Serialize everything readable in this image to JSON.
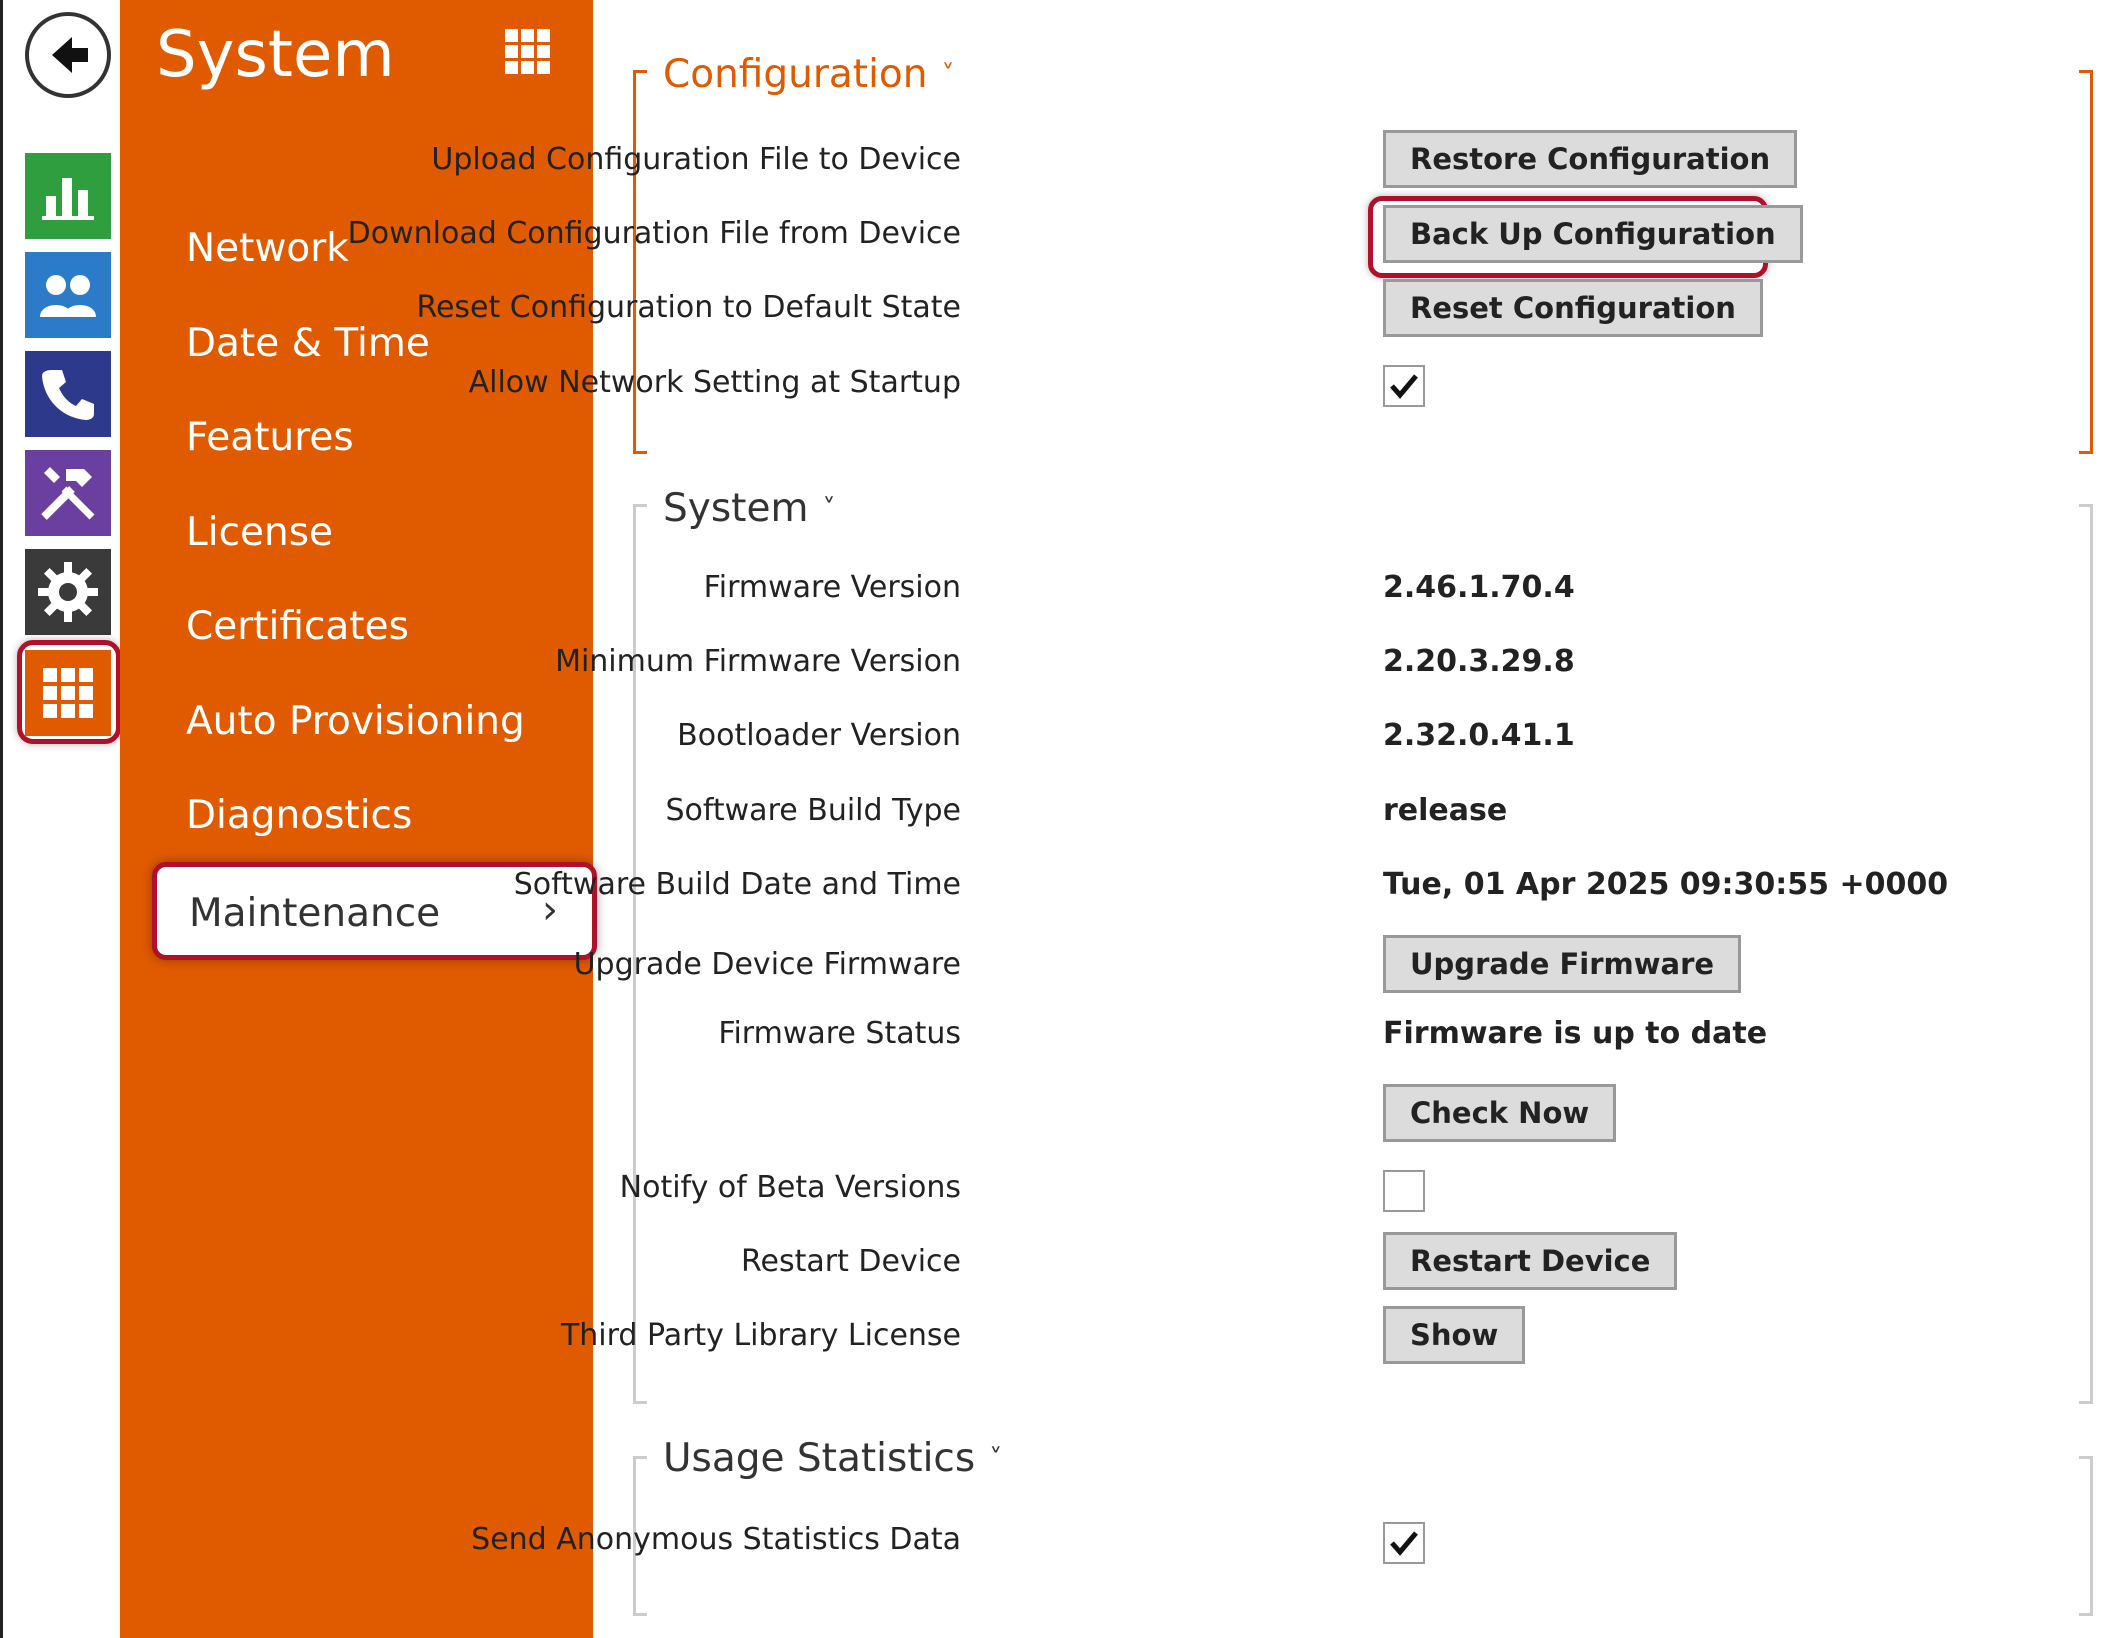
{
  "rail": {
    "icons": [
      "back-arrow-icon",
      "statistics-icon",
      "users-icon",
      "phone-icon",
      "tools-icon",
      "gear-icon",
      "grid-icon"
    ]
  },
  "menu": {
    "title": "System",
    "items": [
      "Network",
      "Date & Time",
      "Features",
      "License",
      "Certificates",
      "Auto Provisioning",
      "Diagnostics"
    ],
    "active": "Maintenance",
    "active_chevron": "›"
  },
  "configuration": {
    "title": "Configuration",
    "chevron": "˅",
    "upload_label": "Upload Configuration File to Device",
    "restore_button": "Restore Configuration",
    "download_label": "Download Configuration File from Device",
    "backup_button": "Back Up Configuration",
    "reset_label": "Reset Configuration to Default State",
    "reset_button": "Reset Configuration",
    "allow_label": "Allow Network Setting at Startup",
    "allow_checked": true
  },
  "system": {
    "title": "System",
    "chevron": "˅",
    "firmware_version_label": "Firmware Version",
    "firmware_version": "2.46.1.70.4",
    "min_firmware_label": "Minimum Firmware Version",
    "min_firmware": "2.20.3.29.8",
    "bootloader_label": "Bootloader Version",
    "bootloader": "2.32.0.41.1",
    "build_type_label": "Software Build Type",
    "build_type": "release",
    "build_date_label": "Software Build Date and Time",
    "build_date": "Tue, 01 Apr 2025 09:30:55 +0000",
    "upgrade_label": "Upgrade Device Firmware",
    "upgrade_button": "Upgrade Firmware",
    "status_label": "Firmware Status",
    "status": "Firmware is up to date",
    "check_button": "Check Now",
    "beta_label": "Notify of Beta Versions",
    "beta_checked": false,
    "restart_label": "Restart Device",
    "restart_button": "Restart Device",
    "license_label": "Third Party Library License",
    "license_button": "Show"
  },
  "usage": {
    "title": "Usage Statistics",
    "chevron": "˅",
    "send_label": "Send Anonymous Statistics Data",
    "send_checked": true
  },
  "colors": {
    "orange": "#e05a00",
    "highlight": "#b0102a",
    "stat_green": "#2e9e3e",
    "users_blue": "#2b7bc8",
    "phone_navy": "#2d3a8c",
    "tools_purple": "#6a3fa0",
    "gear_dark": "#3a3a3a"
  }
}
